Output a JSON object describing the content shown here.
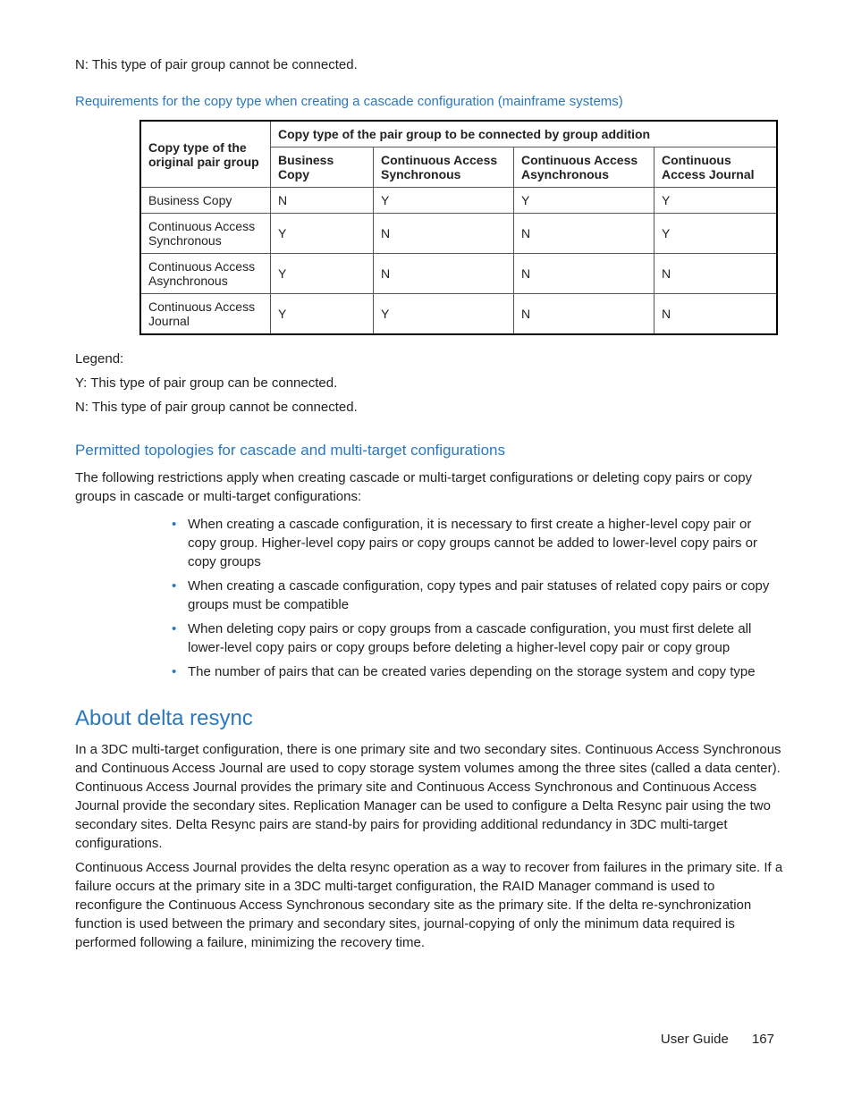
{
  "top_note": "N: This type of pair group cannot be connected.",
  "link1": "Requirements for the copy type when creating a cascade configuration (mainframe systems)",
  "table": {
    "left_header": "Copy type of the original pair group",
    "span_header": "Copy type of the pair group to be connected by group addition",
    "cols": [
      "Business Copy",
      "Continuous Access Synchronous",
      "Continuous Access Asynchronous",
      "Continuous Access Journal"
    ],
    "rows": [
      {
        "name": "Business Copy",
        "vals": [
          "N",
          "Y",
          "Y",
          "Y"
        ]
      },
      {
        "name": "Continuous Access Synchronous",
        "vals": [
          "Y",
          "N",
          "N",
          "Y"
        ]
      },
      {
        "name": "Continuous Access Asynchronous",
        "vals": [
          "Y",
          "N",
          "N",
          "N"
        ]
      },
      {
        "name": "Continuous Access Journal",
        "vals": [
          "Y",
          "Y",
          "N",
          "N"
        ]
      }
    ]
  },
  "legend": {
    "title": "Legend:",
    "y": "Y: This type of pair group can be connected.",
    "n": "N: This type of pair group cannot be connected."
  },
  "h2": "Permitted topologies for cascade and multi-target configurations",
  "h2_intro": "The following restrictions apply when creating cascade or multi-target configurations or deleting copy pairs or copy groups in cascade or multi-target configurations:",
  "bullets": [
    "When creating a cascade configuration, it is necessary to first create a higher-level copy pair or copy group. Higher-level copy pairs or copy groups cannot be added to lower-level copy pairs or copy groups",
    "When creating a cascade configuration, copy types and pair statuses of related copy pairs or copy groups must be compatible",
    "When deleting copy pairs or copy groups from a cascade configuration, you must first delete all lower-level copy pairs or copy groups before deleting a higher-level copy pair or copy group",
    "The number of pairs that can be created varies depending on the storage system and copy type"
  ],
  "h1": "About delta resync",
  "p1": "In a 3DC multi-target configuration, there is one primary site and two secondary sites. Continuous Access Synchronous and Continuous Access Journal are used to copy storage system volumes among the three sites (called a data center). Continuous Access Journal provides the primary site and Continuous Access Synchronous and Continuous Access Journal provide the secondary sites. Replication Manager can be used to configure a Delta Resync pair using the two secondary sites. Delta Resync pairs are stand-by pairs for providing additional redundancy in 3DC multi-target configurations.",
  "p2": "Continuous Access Journal provides the delta resync operation as a way to recover from failures in the primary site. If a failure occurs at the primary site in a 3DC multi-target configuration, the RAID Manager                      command is used to reconfigure the Continuous Access Synchronous secondary site as the primary site. If the delta re-synchronization function is used between the primary and secondary sites, journal-copying of only the minimum data required is performed following a failure, minimizing  the recovery time.",
  "footer": {
    "label": "User Guide",
    "page": "167"
  }
}
